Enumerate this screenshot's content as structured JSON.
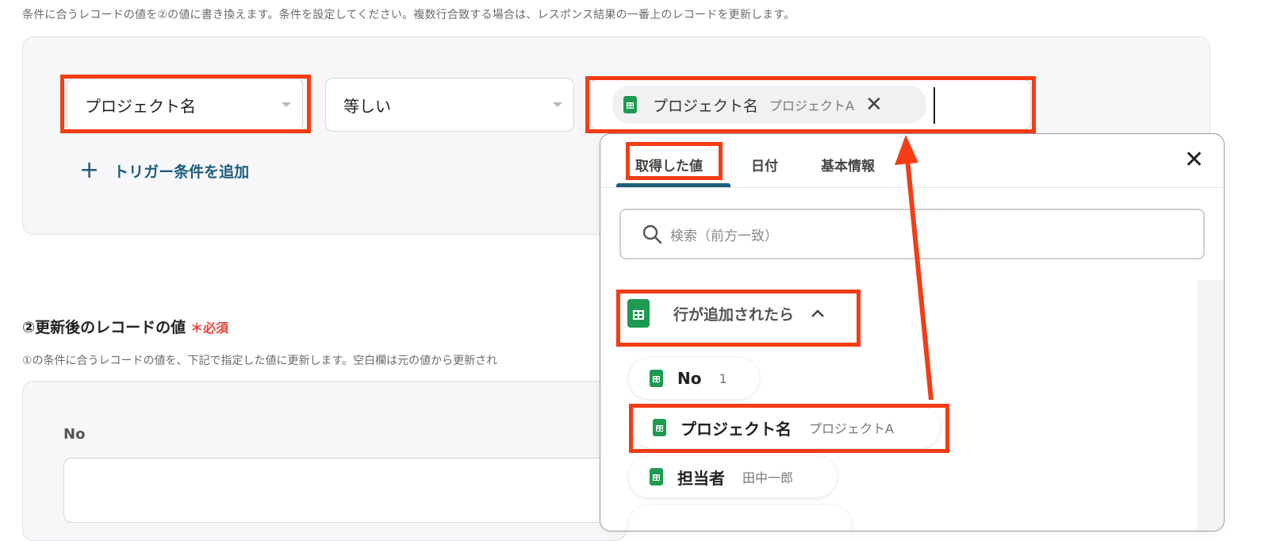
{
  "top_description": "条件に合うレコードの値を②の値に書き換えます。条件を設定してください。複数行合致する場合は、レスポンス結果の一番上のレコードを更新します。",
  "condition": {
    "field_select": "プロジェクト名",
    "operator_select": "等しい",
    "value_chip": {
      "key": "プロジェクト名",
      "value": "プロジェクトA"
    },
    "add_trigger": "トリガー条件を追加"
  },
  "section2": {
    "title": "②更新後のレコードの値",
    "required_mark": "＊",
    "required": "必須",
    "description": "①の条件に合うレコードの値を、下記で指定した値に更新します。空白欄は元の値から更新され",
    "fields": [
      {
        "label": "No",
        "value": ""
      }
    ]
  },
  "popover": {
    "tabs": [
      "取得した値",
      "日付",
      "基本情報"
    ],
    "active_tab": 0,
    "search_placeholder": "検索（前方一致）",
    "group": {
      "label": "行が追加されたら"
    },
    "items": [
      {
        "key": "No",
        "value": "1"
      },
      {
        "key": "プロジェクト名",
        "value": "プロジェクトA"
      },
      {
        "key": "担当者",
        "value": "田中一郎"
      }
    ]
  },
  "colors": {
    "accent": "#1d5d7c",
    "highlight": "#f53c14",
    "sheet_green": "#1e9a51",
    "required": "#e8413a"
  }
}
